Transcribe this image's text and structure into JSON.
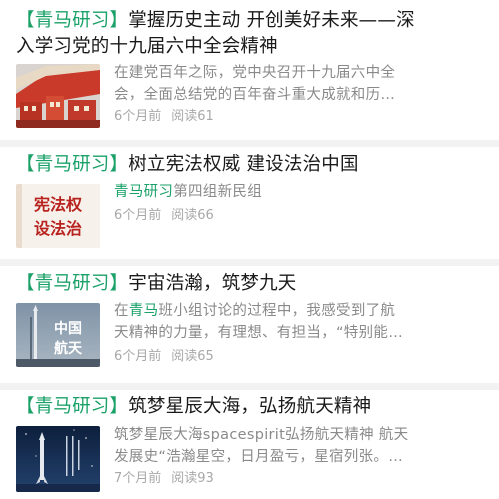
{
  "articles": [
    {
      "tag": "【青马研习】",
      "title_line1": "掌握历史主动 开创美好未来——深",
      "title_line2": "入学习党的十九届六中全会精神",
      "snippet_line1": "在建党百年之际，党中央召开十九届六中全",
      "snippet_line2": "会，全面总结党的百年奋斗重大成就和历…",
      "time": "6个月前",
      "reads": "阅读61",
      "thumb_icon": "red-building-photo"
    },
    {
      "tag": "【青马研习】",
      "title": "树立宪法权威 建设法治中国",
      "snippet_highlight": "青马研习",
      "snippet_rest": "第四组新民组",
      "time": "6个月前",
      "reads": "阅读66",
      "thumb_line1": "宪法权",
      "thumb_line2": "设法治",
      "thumb_icon": "calligraphy-banner"
    },
    {
      "tag": "【青马研习】",
      "title": "宇宙浩瀚，筑梦九天",
      "snippet_pre": "在",
      "snippet_highlight": "青马",
      "snippet_post": "班小组讨论的过程中，我感受到了航",
      "snippet_line2": "天精神的力量，有理想、有担当，“特别能…",
      "time": "6个月前",
      "reads": "阅读65",
      "thumb_line1": "中国",
      "thumb_line2": "航天",
      "thumb_icon": "rocket-launch-photo"
    },
    {
      "tag": "【青马研习】",
      "title": "筑梦星辰大海，弘扬航天精神",
      "snippet_line1": "筑梦星辰大海spacespirit弘扬航天精神 航天",
      "snippet_line2": "发展史“浩瀚星空，日月盈亏，星宿列张。…",
      "time": "7个月前",
      "reads": "阅读93",
      "thumb_icon": "space-poster"
    }
  ],
  "colors": {
    "tag": "#1aa168",
    "title": "#1a1a1a",
    "snippet": "#8a8a8a",
    "meta": "#a8a8a8",
    "separator": "#f2f2f2"
  }
}
